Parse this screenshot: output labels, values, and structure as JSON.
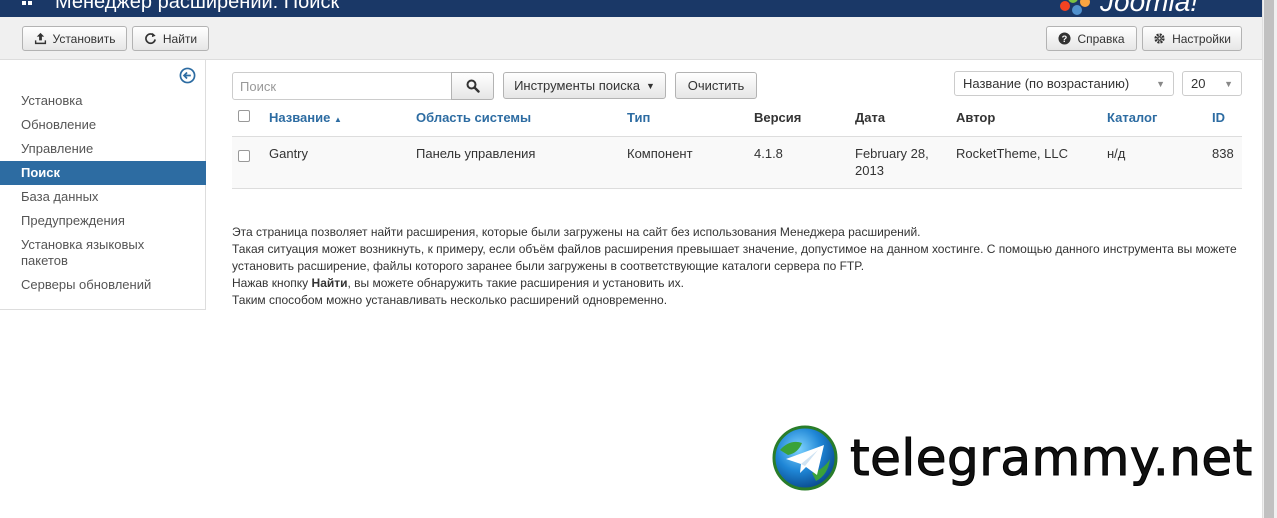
{
  "header": {
    "title": "Менеджер расширений: Поиск",
    "brand": "Joomla!"
  },
  "toolbar": {
    "install_label": "Установить",
    "find_label": "Найти",
    "help_label": "Справка",
    "settings_label": "Настройки"
  },
  "sidebar": {
    "items": [
      {
        "label": "Установка"
      },
      {
        "label": "Обновление"
      },
      {
        "label": "Управление"
      },
      {
        "label": "Поиск",
        "active": true
      },
      {
        "label": "База данных"
      },
      {
        "label": "Предупреждения"
      },
      {
        "label": "Установка языковых пакетов"
      },
      {
        "label": "Серверы обновлений"
      }
    ]
  },
  "filters": {
    "search_placeholder": "Поиск",
    "search_tools_label": "Инструменты поиска",
    "clear_label": "Очистить",
    "sort_value": "Название (по возрастанию)",
    "limit_value": "20"
  },
  "table": {
    "columns": {
      "name": "Название",
      "location": "Область системы",
      "type": "Тип",
      "version": "Версия",
      "date": "Дата",
      "author": "Автор",
      "folder": "Каталог",
      "id": "ID"
    },
    "rows": [
      {
        "name": "Gantry",
        "location": "Панель управления",
        "type": "Компонент",
        "version": "4.1.8",
        "date": "February 28, 2013",
        "author": "RocketTheme, LLC",
        "folder": "н/д",
        "id": "838"
      }
    ]
  },
  "info": {
    "line1": "Эта страница позволяет найти расширения, которые были загружены на сайт без использования Менеджера расширений.",
    "line2": "Такая ситуация может возникнуть, к примеру, если объём файлов расширения превышает значение, допустимое на данном хостинге. С помощью данного инструмента вы можете установить расширение, файлы которого заранее были загружены в соответствующие каталоги сервера по FTP.",
    "line3_before": "Нажав кнопку ",
    "line3_bold": "Найти",
    "line3_after": ", вы можете обнаружить такие расширения и установить их.",
    "line4": "Таким способом можно устанавливать несколько расширений одновременно."
  },
  "watermark": {
    "text": "telegrammy.net"
  },
  "colors": {
    "header_bg": "#1a3867",
    "active_nav": "#2d6ca2",
    "link": "#2d6ca2"
  }
}
